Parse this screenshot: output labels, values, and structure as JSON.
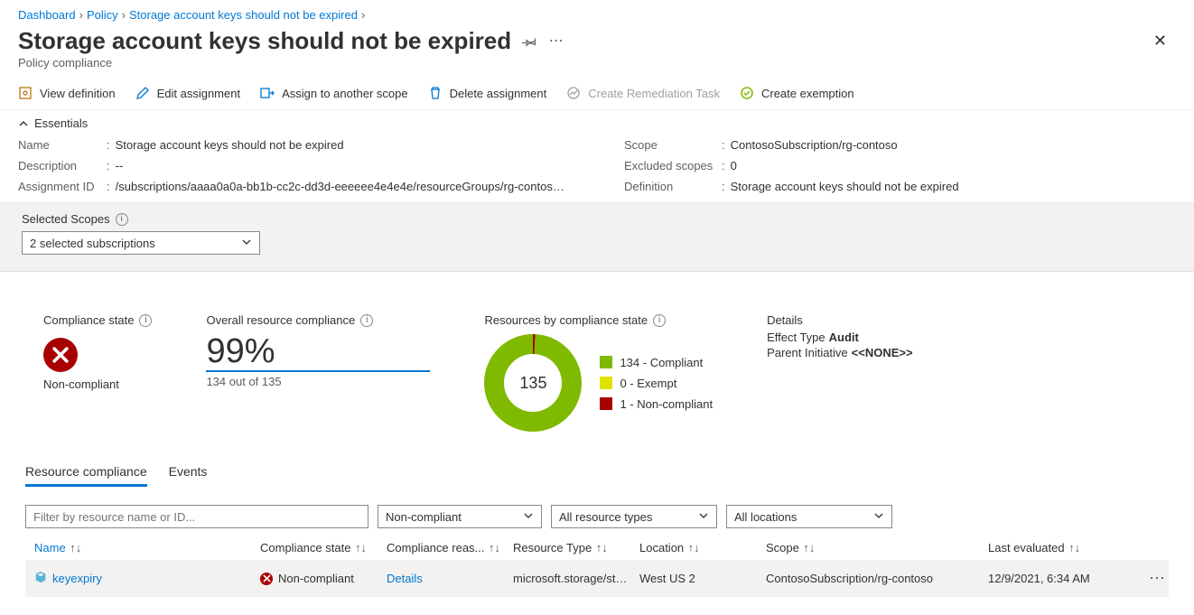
{
  "breadcrumb": {
    "items": [
      "Dashboard",
      "Policy",
      "Storage account keys should not be expired"
    ]
  },
  "header": {
    "title": "Storage account keys should not be expired",
    "subtitle": "Policy compliance"
  },
  "toolbar": {
    "view": "View definition",
    "edit": "Edit assignment",
    "assign": "Assign to another scope",
    "del": "Delete assignment",
    "remed": "Create Remediation Task",
    "exempt": "Create exemption"
  },
  "essentials": {
    "toggle_label": "Essentials",
    "name_label": "Name",
    "name_val": "Storage account keys should not be expired",
    "desc_label": "Description",
    "desc_val": "--",
    "aid_label": "Assignment ID",
    "aid_val": "/subscriptions/aaaa0a0a-bb1b-cc2c-dd3d-eeeeee4e4e4e/resourceGroups/rg-contoso…",
    "scope_label": "Scope",
    "scope_val": "ContosoSubscription/rg-contoso",
    "ex_label": "Excluded scopes",
    "ex_val": "0",
    "def_label": "Definition",
    "def_val": "Storage account keys should not be expired"
  },
  "scopes": {
    "label": "Selected Scopes",
    "value": "2 selected subscriptions"
  },
  "stats": {
    "compliance_state_label": "Compliance state",
    "compliance_state_value": "Non-compliant",
    "overall_label": "Overall resource compliance",
    "overall_pct": "99%",
    "overall_sub": "134 out of 135",
    "bycomp_label": "Resources by compliance state",
    "donut_total": "135",
    "legend_compliant": "134 - Compliant",
    "legend_exempt": "0 - Exempt",
    "legend_noncompliant": "1 - Non-compliant",
    "details_label": "Details",
    "effect_label": "Effect Type",
    "effect_val": "Audit",
    "parent_label": "Parent Initiative",
    "parent_val": "<<NONE>>"
  },
  "tabs": {
    "t1": "Resource compliance",
    "t2": "Events"
  },
  "filters": {
    "search_placeholder": "Filter by resource name or ID...",
    "compliance": "Non-compliant",
    "types": "All resource types",
    "locations": "All locations"
  },
  "table": {
    "headers": {
      "name": "Name",
      "state": "Compliance state",
      "reason": "Compliance reas...",
      "type": "Resource Type",
      "loc": "Location",
      "scope": "Scope",
      "last": "Last evaluated"
    },
    "row": {
      "name": "keyexpiry",
      "state": "Non-compliant",
      "reason": "Details",
      "type": "microsoft.storage/st…",
      "loc": "West US 2",
      "scope": "ContosoSubscription/rg-contoso",
      "last": "12/9/2021, 6:34 AM"
    }
  }
}
